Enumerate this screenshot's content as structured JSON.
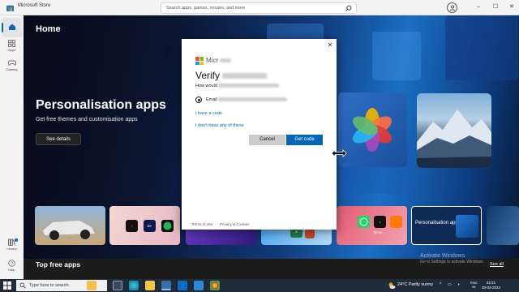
{
  "window": {
    "app_title": "Microsoft Store",
    "minimize": "–",
    "maximize": "☐",
    "close": "✕"
  },
  "search": {
    "placeholder": "Search apps, games, movies, and more"
  },
  "sidebar": {
    "items": [
      {
        "label": "",
        "icon": "home-icon"
      },
      {
        "label": "Apps",
        "icon": "apps-icon"
      },
      {
        "label": "Gaming",
        "icon": "gaming-icon"
      },
      {
        "label": "Library",
        "icon": "library-icon"
      },
      {
        "label": "Help",
        "icon": "help-icon"
      }
    ]
  },
  "hero": {
    "page_title": "Home",
    "title": "Personalisation apps",
    "subtitle": "Get free themes and customisation apps",
    "cta": "See details"
  },
  "cards": {
    "personalisation_label": "Personalisation apps",
    "tiktok_label": "TikTok"
  },
  "section": {
    "title": "Top free apps",
    "see_all": "See all"
  },
  "watermark": {
    "title": "Activate Windows",
    "subtitle": "Go to Settings to activate Windows."
  },
  "dialog": {
    "brand": "Micr",
    "title": "Verify",
    "description": "How would",
    "option_label": "Email",
    "link_have_code": "I have a code",
    "link_dont_have": "I don't have any of these",
    "cancel": "Cancel",
    "get_code": "Get code",
    "close": "✕",
    "footer_terms": "Terms of Use",
    "footer_privacy": "Privacy & Cookies"
  },
  "taskbar": {
    "search_placeholder": "Type here to search",
    "weather": "24°C  Partly sunny",
    "lang_top": "ENG",
    "lang_bottom": "IN",
    "time": "22:21",
    "date": "30-03-2023"
  },
  "colors": {
    "accent": "#0067b8",
    "hero_blue": "#1a6fc4"
  }
}
